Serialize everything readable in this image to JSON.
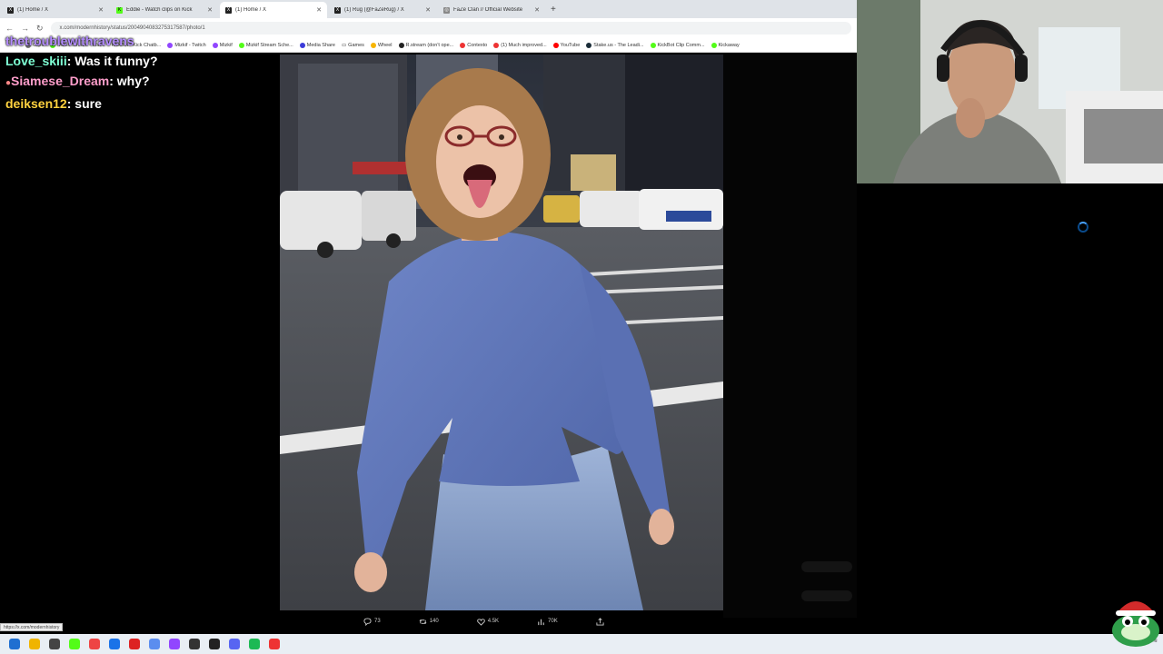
{
  "browser": {
    "tabs": [
      {
        "label": "(1) Home / X",
        "icon": "x-icon",
        "active": false
      },
      {
        "label": "Eddie - Watch clips on Kick",
        "icon": "kick-icon",
        "active": false
      },
      {
        "label": "(1) Home / X",
        "icon": "x-icon",
        "active": true
      },
      {
        "label": "(1) Rug (@FaZeRug) / X",
        "icon": "x-icon",
        "active": false
      },
      {
        "label": "FaZe Clan // Official Website",
        "icon": "globe-icon",
        "active": false
      }
    ],
    "url": "x.com/modernhistory/status/2004904083275317587/photo/1",
    "status_url": "https://x.com/modernhistory",
    "bookmarks": [
      "Clips",
      "Mizkif Stream - Wat...",
      "KickBot - Kick Chatb...",
      "Mizkif - Twitch",
      "Mizkif",
      "Mizkif Stream Sche...",
      "Media Share",
      "Games",
      "Wheel",
      "R.stream (don't ope...",
      "Contexto",
      "(1) Much improved...",
      "YouTube",
      "Stake.us - The Leadi...",
      "KickBot Clip Comm...",
      "Kickaway"
    ]
  },
  "chat": {
    "lines": [
      {
        "user": "thetroublewithravens",
        "color": "#b48cff",
        "text": ""
      },
      {
        "user": "Love_skiii",
        "color": "#7fffd4",
        "text": "Was it funny?"
      },
      {
        "user": "Siamese_Dream",
        "color": "#ff9ecb",
        "text": "why?"
      },
      {
        "user": "deiksen12",
        "color": "#ffd23f",
        "text": "sure"
      }
    ]
  },
  "post_actions": {
    "replies": "73",
    "reposts": "140",
    "likes": "4.5K",
    "views": "70K"
  },
  "colors": {
    "taskbar": "#e9eef4",
    "tab_bar": "#dfe3e8",
    "page_bg": "#000000"
  }
}
